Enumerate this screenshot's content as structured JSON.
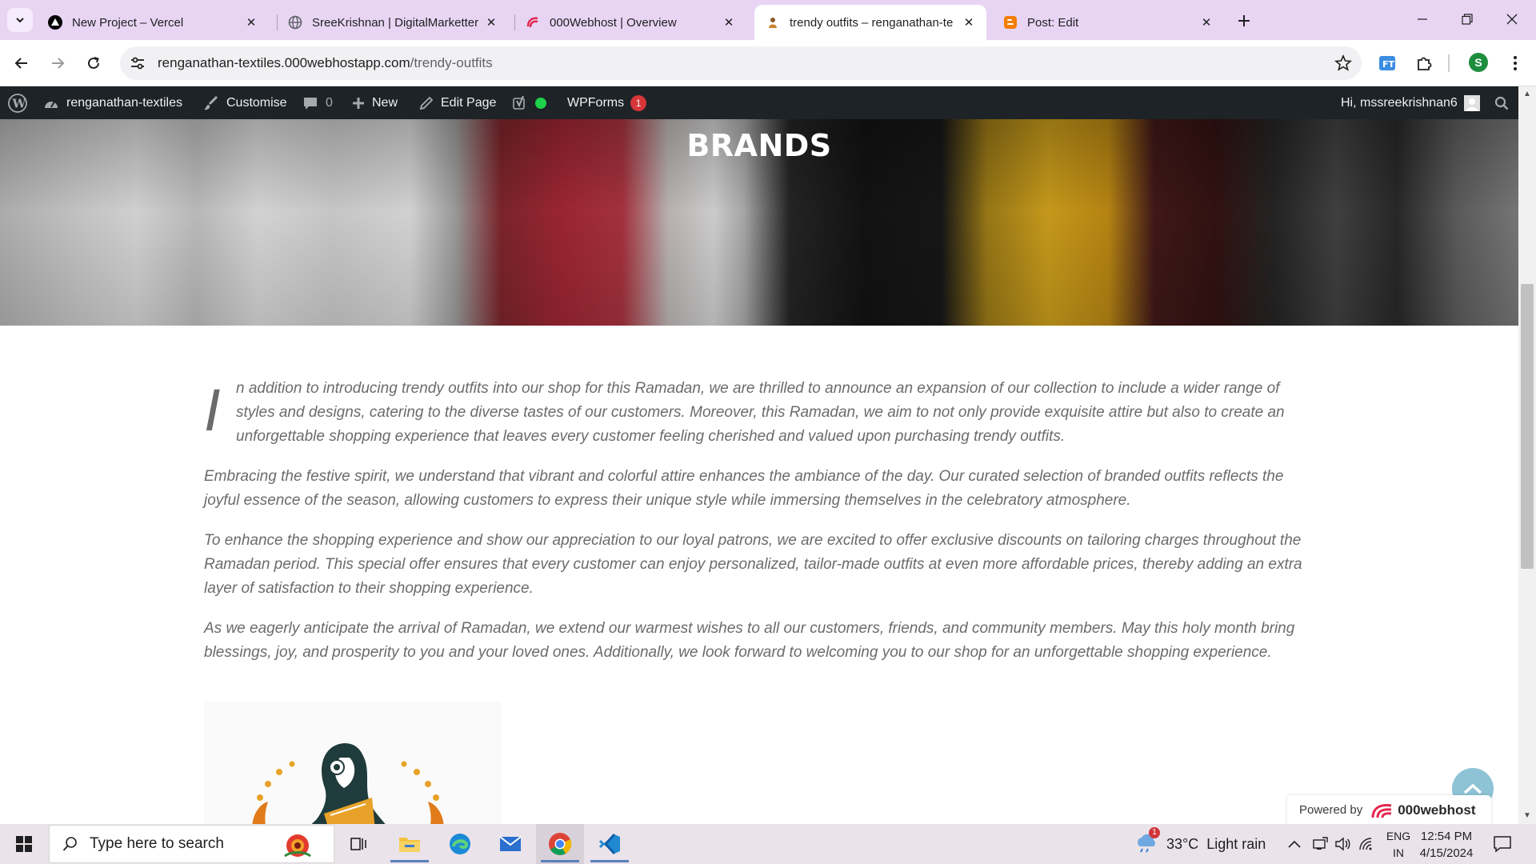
{
  "browser": {
    "tabs": [
      {
        "title": "New Project – Vercel",
        "favicon": "vercel-icon",
        "active": false
      },
      {
        "title": "SreeKrishnan | DigitalMarketter",
        "favicon": "globe-icon",
        "active": false
      },
      {
        "title": "000Webhost | Overview",
        "favicon": "000webhost-icon",
        "active": false
      },
      {
        "title": "trendy outfits – renganathan-te",
        "favicon": "site-icon",
        "active": true
      },
      {
        "title": "Post: Edit",
        "favicon": "blogger-icon",
        "active": false
      }
    ],
    "close_glyph": "✕",
    "url_host": "renganathan-textiles.000webhostapp.com",
    "url_path": "/trendy-outfits",
    "profile_initial": "S"
  },
  "adminbar": {
    "site_name": "renganathan-textiles",
    "customise": "Customise",
    "comments_count": "0",
    "new": "New",
    "edit_page": "Edit Page",
    "wpforms": "WPForms",
    "wpforms_badge": "1",
    "greeting": "Hi, mssreekrishnan6"
  },
  "page": {
    "hero_title": "BRANDS",
    "dropcap": "I",
    "paragraph1": "n addition to introducing trendy outfits into our shop for this Ramadan, we are thrilled to announce an expansion of our collection to include a wider range of styles and designs, catering to the diverse tastes of our customers. Moreover, this Ramadan, we aim to not only provide exquisite attire but also to create an unforgettable shopping experience that leaves every customer feeling cherished and valued upon purchasing trendy outfits.",
    "paragraph2": "Embracing the festive spirit, we understand that vibrant and colorful attire enhances the ambiance of the day. Our curated selection of branded outfits reflects the joyful essence of the season, allowing customers to express their unique style while immersing themselves in the celebratory atmosphere.",
    "paragraph3": "To enhance the shopping experience and show our appreciation to our loyal patrons, we are excited to offer exclusive discounts on tailoring charges throughout the Ramadan period. This special offer ensures that every customer can enjoy personalized, tailor-made outfits at even more affordable prices, thereby adding an extra layer of satisfaction to their shopping experience.",
    "paragraph4": "As we eagerly anticipate the arrival of Ramadan, we extend our warmest wishes to all our customers, friends, and community members. May this holy month bring blessings, joy, and prosperity to you and your loved ones. Additionally, we look forward to welcoming you to our shop for an unforgettable shopping experience.",
    "powered_by": "Powered by",
    "powered_brand": "000webhost"
  },
  "taskbar": {
    "search_placeholder": "Type here to search",
    "weather_temp": "33°C",
    "weather_text": "Light rain",
    "weather_badge": "1",
    "lang_top": "ENG",
    "lang_bottom": "IN",
    "time": "12:54 PM",
    "date": "4/15/2024"
  },
  "colors": {
    "tabstrip": "#e8d5f4",
    "adminbar": "#1d2327",
    "article_text": "#6b6b6b",
    "taskbar": "#eae3ea"
  }
}
